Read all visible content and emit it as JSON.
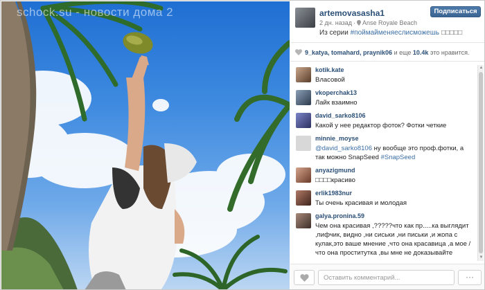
{
  "photo": {
    "watermark": "schock.su - новости дома 2"
  },
  "post": {
    "username": "artemovasasha1",
    "time_ago": "2 дн. назад",
    "location": "Anse Royale Beach",
    "caption_prefix": "Из серии ",
    "caption_tag": "#поймайменяеслисможешь",
    "caption_emoji": "□□□□□",
    "follow_label": "Подписаться"
  },
  "likes": {
    "users": "9_katya, tomahard, praynik06",
    "and_more": " и еще ",
    "count": "10.4k",
    "suffix": " это нравится."
  },
  "comments": [
    {
      "user": "kotik.kate",
      "text": "Власовой"
    },
    {
      "user": "vkoperchak13",
      "text": "Лайк взаимно"
    },
    {
      "user": "david_sarko8106",
      "text": "Какой у нее редактор фоток? Фотки четкие"
    },
    {
      "user": "minnie_moyse",
      "mention": "@david_sarko8106",
      "text": " ну вообще это проф.фотки, а так можно SnapSeed ",
      "tag": "#SnapSeed"
    },
    {
      "user": "anyazigmund",
      "text": "□□□□красиво"
    },
    {
      "user": "erlik1983nur",
      "text": "Ты очень красивая и молодая"
    },
    {
      "user": "galya.pronina.59",
      "text": "Чем она красивая ,?????что как пр.....ка выглядит ,пифчик, видно ,ни сиськи ,ни письки ,и жопа с кулак,это ваше мнение ,что она красавица ,а мое / что она проститутка ,вы мне не доказывайте"
    }
  ],
  "footer": {
    "comment_placeholder": "Оставить комментарий...",
    "more_label": "···"
  },
  "colors": {
    "link": "#2b4f77",
    "tag": "#3a6ea5",
    "follow_button": "#3b6593"
  }
}
